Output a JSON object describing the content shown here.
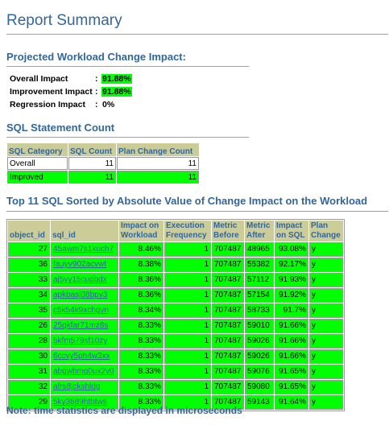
{
  "report_title": "Report Summary",
  "workload_heading": "Projected Workload Change Impact:",
  "impact_rows": [
    {
      "label": "Overall Impact",
      "sep": ":",
      "value": "91.88%",
      "highlight": true
    },
    {
      "label": "Improvement Impact",
      "sep": ":",
      "value": "91.88%",
      "highlight": true
    },
    {
      "label": "Regression Impact",
      "sep": ":",
      "value": "0%",
      "highlight": false
    }
  ],
  "count_heading": "SQL Statement Count",
  "count_table": {
    "headers": [
      "SQL Category",
      "SQL Count",
      "Plan Change Count"
    ],
    "rows": [
      {
        "category": "Overall",
        "sql_count": "11",
        "plan_change_count": "11",
        "highlight": false
      },
      {
        "category": "Improved",
        "sql_count": "11",
        "plan_change_count": "11",
        "highlight": true
      }
    ]
  },
  "top_heading": "Top 11 SQL Sorted by Absolute Value of Change Impact on the Workload",
  "top_table": {
    "headers": {
      "object_id": "object_id",
      "sql_id": "sql_id",
      "impact_wl_1": "Impact on",
      "impact_wl_2": "Workload",
      "exec_1": "Execution",
      "exec_2": "Frequency",
      "before_1": "Metric",
      "before_2": "Before",
      "after_1": "Metric",
      "after_2": "After",
      "impact_sql_1": "Impact",
      "impact_sql_2": "on SQL",
      "plan_1": "Plan",
      "plan_2": "Change"
    },
    "rows": [
      {
        "object_id": "27",
        "sql_id": "45awm7s1kuch7",
        "impact_workload": "8.46%",
        "exec_freq": "1",
        "metric_before": "707487",
        "metric_after": "48965",
        "impact_sql": "93.08%",
        "plan_change": "y"
      },
      {
        "object_id": "36",
        "sql_id": "fauyv902acvwt",
        "impact_workload": "8.38%",
        "exec_freq": "1",
        "metric_before": "707487",
        "metric_after": "55382",
        "impact_sql": "92.17%",
        "plan_change": "y"
      },
      {
        "object_id": "33",
        "sql_id": "aj5yy15cudbdx",
        "impact_workload": "8.36%",
        "exec_freq": "1",
        "metric_before": "707487",
        "metric_after": "57112",
        "impact_sql": "91.93%",
        "plan_change": "y"
      },
      {
        "object_id": "34",
        "sql_id": "apkbasj08bpv3",
        "impact_workload": "8.36%",
        "exec_freq": "1",
        "metric_before": "707487",
        "metric_after": "57154",
        "impact_sql": "91.92%",
        "plan_change": "y"
      },
      {
        "object_id": "35",
        "sql_id": "c5k54k9xchgyn",
        "impact_workload": "8.34%",
        "exec_freq": "1",
        "metric_before": "707487",
        "metric_after": "58733",
        "impact_sql": "91.7%",
        "plan_change": "y"
      },
      {
        "object_id": "26",
        "sql_id": "25qkfar71mz8s",
        "impact_workload": "8.33%",
        "exec_freq": "1",
        "metric_before": "707487",
        "metric_after": "59010",
        "impact_sql": "91.66%",
        "plan_change": "y"
      },
      {
        "object_id": "28",
        "sql_id": "5kfm579sf10zy",
        "impact_workload": "8.33%",
        "exec_freq": "1",
        "metric_before": "707487",
        "metric_after": "59026",
        "impact_sql": "91.66%",
        "plan_change": "y"
      },
      {
        "object_id": "30",
        "sql_id": "6ccvy5ph4w3xx",
        "impact_workload": "8.33%",
        "exec_freq": "1",
        "metric_before": "707487",
        "metric_after": "59026",
        "impact_sql": "91.66%",
        "plan_change": "y"
      },
      {
        "object_id": "31",
        "sql_id": "abgwbmg0ux2y0",
        "impact_workload": "8.33%",
        "exec_freq": "1",
        "metric_before": "707487",
        "metric_after": "59076",
        "impact_sql": "91.65%",
        "plan_change": "y"
      },
      {
        "object_id": "32",
        "sql_id": "afrs8jckshldg",
        "impact_workload": "8.33%",
        "exec_freq": "1",
        "metric_before": "707487",
        "metric_after": "59080",
        "impact_sql": "91.65%",
        "plan_change": "y"
      },
      {
        "object_id": "29",
        "sql_id": "5ky3889htbtws",
        "impact_workload": "8.33%",
        "exec_freq": "1",
        "metric_before": "707487",
        "metric_after": "59143",
        "impact_sql": "91.64%",
        "plan_change": "y"
      }
    ]
  },
  "footer_note": "Note: time statistics are displayed in microseconds",
  "colors": {
    "heading": "#336699",
    "highlight": "#00ff00",
    "header_bg": "#cccc99"
  }
}
